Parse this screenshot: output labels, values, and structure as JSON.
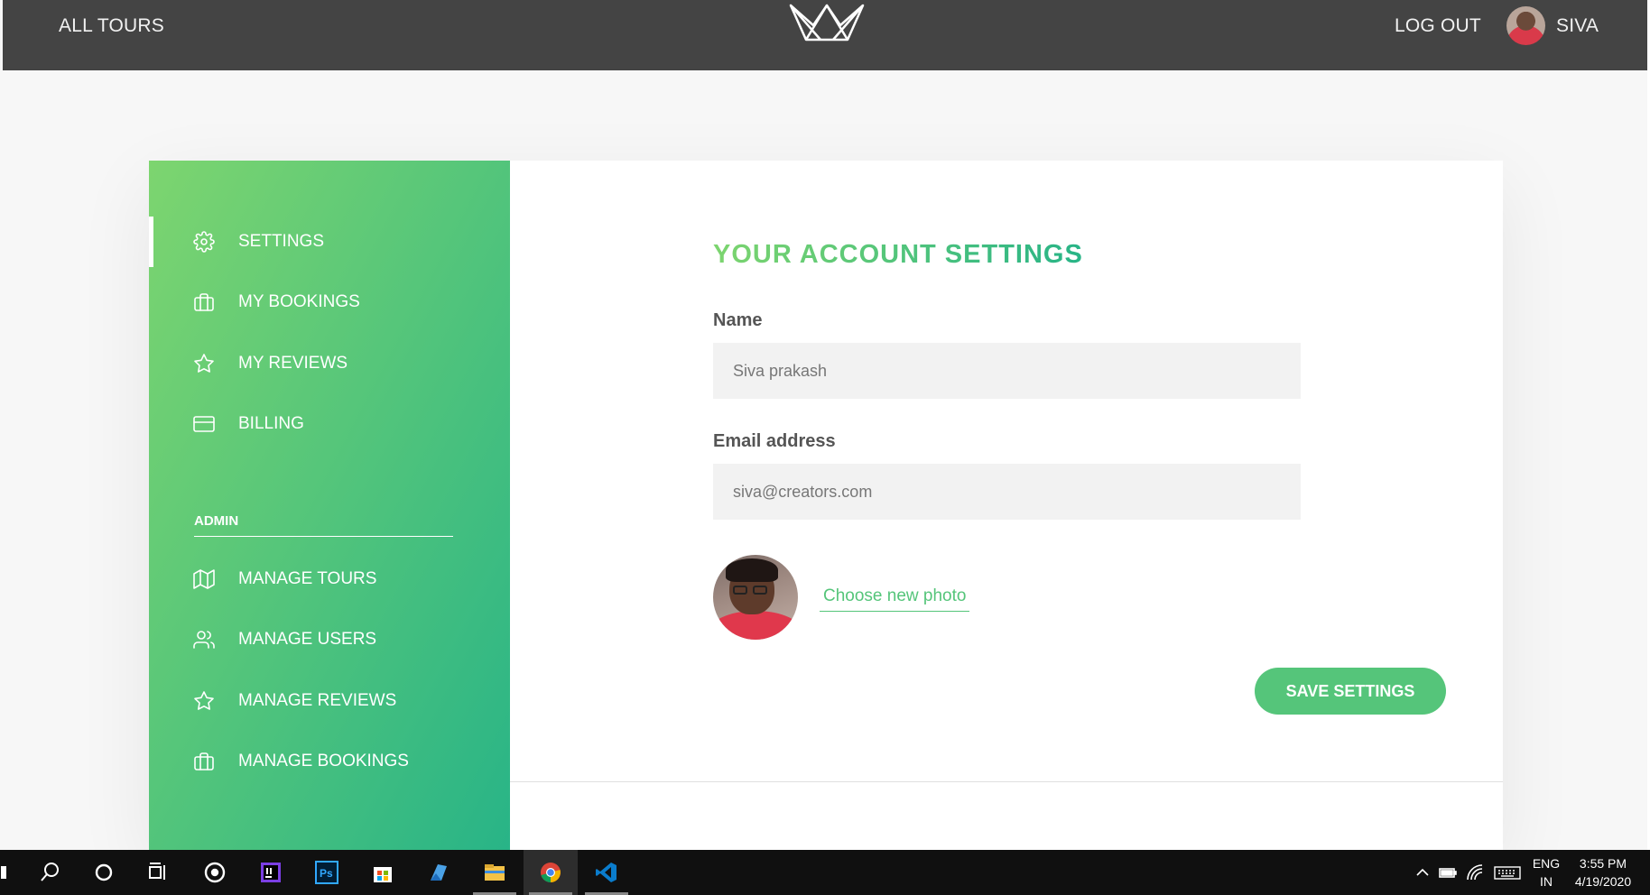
{
  "header": {
    "all_tours": "ALL TOURS",
    "logout": "LOG OUT",
    "user_name": "SIVA"
  },
  "sidebar": {
    "items": [
      {
        "label": "SETTINGS",
        "icon": "gear-icon",
        "active": true
      },
      {
        "label": "MY BOOKINGS",
        "icon": "briefcase-icon"
      },
      {
        "label": "MY REVIEWS",
        "icon": "star-icon"
      },
      {
        "label": "BILLING",
        "icon": "credit-card-icon"
      }
    ],
    "admin_heading": "ADMIN",
    "admin_items": [
      {
        "label": "MANAGE TOURS",
        "icon": "map-icon"
      },
      {
        "label": "MANAGE USERS",
        "icon": "users-icon"
      },
      {
        "label": "MANAGE REVIEWS",
        "icon": "star-icon"
      },
      {
        "label": "MANAGE BOOKINGS",
        "icon": "briefcase-icon"
      }
    ]
  },
  "settings": {
    "title": "YOUR ACCOUNT SETTINGS",
    "name_label": "Name",
    "name_value": "Siva prakash",
    "email_label": "Email address",
    "email_value": "siva@creators.com",
    "choose_photo": "Choose new photo",
    "save_button": "SAVE SETTINGS"
  },
  "taskbar": {
    "lang_top": "ENG",
    "lang_bottom": "IN",
    "time": "3:55 PM",
    "date": "4/19/2020"
  },
  "colors": {
    "accent": "#55c57a",
    "gradient_start": "#7dd56f",
    "gradient_end": "#28b487",
    "header_bg": "#444444"
  }
}
